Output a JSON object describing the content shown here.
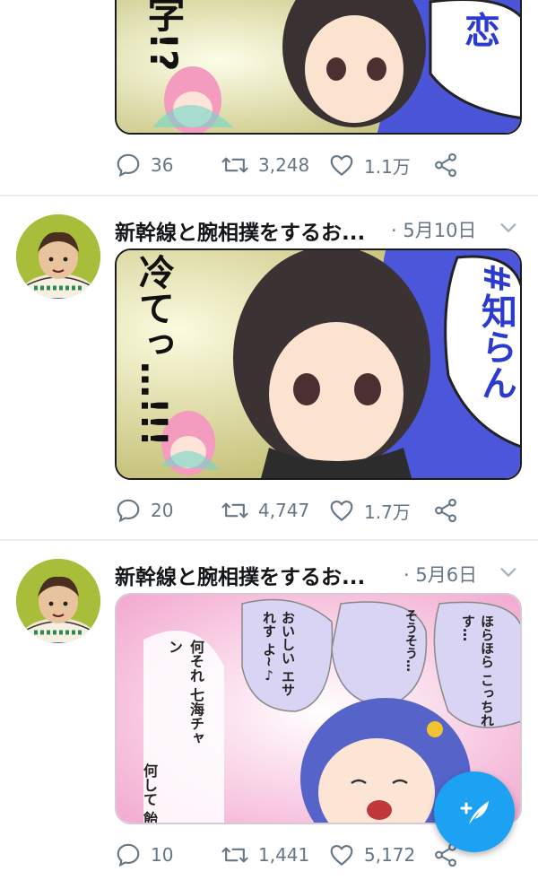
{
  "tweets": [
    {
      "stats": {
        "replies": "36",
        "retweets": "3,248",
        "likes": "1.1万"
      },
      "art_text": {
        "left": "字!?",
        "right": "恋"
      }
    },
    {
      "author": "新幹線と腕相撲をするお...",
      "date": "· 5月10日",
      "stats": {
        "replies": "20",
        "retweets": "4,747",
        "likes": "1.7万"
      },
      "art_text": {
        "left": "冷てっ…!!!",
        "right": "#知らん"
      }
    },
    {
      "author": "新幹線と腕相撲をするお...",
      "date": "· 5月6日",
      "stats": {
        "replies": "10",
        "retweets": "1,441",
        "likes": "5,172"
      },
      "art_text": {
        "bubble1": "ほらほら こっちれす…",
        "bubble2": "そうそう…",
        "bubble3": "おいしい エサれす よ~♪",
        "bubble4": "何それ 七海チャン",
        "bubble5": "何して 飴"
      }
    }
  ],
  "icons": {
    "reply": "reply-icon",
    "retweet": "retweet-icon",
    "like": "heart-icon",
    "share": "share-icon",
    "menu": "chevron-down-icon",
    "compose": "compose-tweet-icon"
  },
  "colors": {
    "accent": "#1da1f2",
    "muted": "#657786",
    "divider": "#e6ecf0"
  }
}
